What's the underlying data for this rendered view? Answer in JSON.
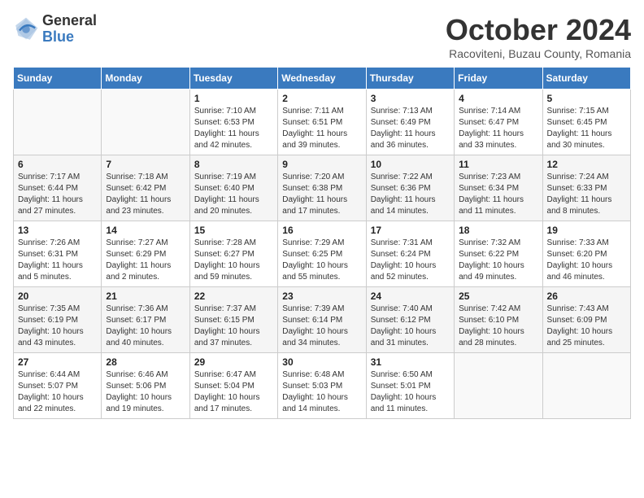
{
  "header": {
    "logo_general": "General",
    "logo_blue": "Blue",
    "month_title": "October 2024",
    "location": "Racoviteni, Buzau County, Romania"
  },
  "days_of_week": [
    "Sunday",
    "Monday",
    "Tuesday",
    "Wednesday",
    "Thursday",
    "Friday",
    "Saturday"
  ],
  "weeks": [
    [
      {
        "day": "",
        "sunrise": "",
        "sunset": "",
        "daylight": ""
      },
      {
        "day": "",
        "sunrise": "",
        "sunset": "",
        "daylight": ""
      },
      {
        "day": "1",
        "sunrise": "Sunrise: 7:10 AM",
        "sunset": "Sunset: 6:53 PM",
        "daylight": "Daylight: 11 hours and 42 minutes."
      },
      {
        "day": "2",
        "sunrise": "Sunrise: 7:11 AM",
        "sunset": "Sunset: 6:51 PM",
        "daylight": "Daylight: 11 hours and 39 minutes."
      },
      {
        "day": "3",
        "sunrise": "Sunrise: 7:13 AM",
        "sunset": "Sunset: 6:49 PM",
        "daylight": "Daylight: 11 hours and 36 minutes."
      },
      {
        "day": "4",
        "sunrise": "Sunrise: 7:14 AM",
        "sunset": "Sunset: 6:47 PM",
        "daylight": "Daylight: 11 hours and 33 minutes."
      },
      {
        "day": "5",
        "sunrise": "Sunrise: 7:15 AM",
        "sunset": "Sunset: 6:45 PM",
        "daylight": "Daylight: 11 hours and 30 minutes."
      }
    ],
    [
      {
        "day": "6",
        "sunrise": "Sunrise: 7:17 AM",
        "sunset": "Sunset: 6:44 PM",
        "daylight": "Daylight: 11 hours and 27 minutes."
      },
      {
        "day": "7",
        "sunrise": "Sunrise: 7:18 AM",
        "sunset": "Sunset: 6:42 PM",
        "daylight": "Daylight: 11 hours and 23 minutes."
      },
      {
        "day": "8",
        "sunrise": "Sunrise: 7:19 AM",
        "sunset": "Sunset: 6:40 PM",
        "daylight": "Daylight: 11 hours and 20 minutes."
      },
      {
        "day": "9",
        "sunrise": "Sunrise: 7:20 AM",
        "sunset": "Sunset: 6:38 PM",
        "daylight": "Daylight: 11 hours and 17 minutes."
      },
      {
        "day": "10",
        "sunrise": "Sunrise: 7:22 AM",
        "sunset": "Sunset: 6:36 PM",
        "daylight": "Daylight: 11 hours and 14 minutes."
      },
      {
        "day": "11",
        "sunrise": "Sunrise: 7:23 AM",
        "sunset": "Sunset: 6:34 PM",
        "daylight": "Daylight: 11 hours and 11 minutes."
      },
      {
        "day": "12",
        "sunrise": "Sunrise: 7:24 AM",
        "sunset": "Sunset: 6:33 PM",
        "daylight": "Daylight: 11 hours and 8 minutes."
      }
    ],
    [
      {
        "day": "13",
        "sunrise": "Sunrise: 7:26 AM",
        "sunset": "Sunset: 6:31 PM",
        "daylight": "Daylight: 11 hours and 5 minutes."
      },
      {
        "day": "14",
        "sunrise": "Sunrise: 7:27 AM",
        "sunset": "Sunset: 6:29 PM",
        "daylight": "Daylight: 11 hours and 2 minutes."
      },
      {
        "day": "15",
        "sunrise": "Sunrise: 7:28 AM",
        "sunset": "Sunset: 6:27 PM",
        "daylight": "Daylight: 10 hours and 59 minutes."
      },
      {
        "day": "16",
        "sunrise": "Sunrise: 7:29 AM",
        "sunset": "Sunset: 6:25 PM",
        "daylight": "Daylight: 10 hours and 55 minutes."
      },
      {
        "day": "17",
        "sunrise": "Sunrise: 7:31 AM",
        "sunset": "Sunset: 6:24 PM",
        "daylight": "Daylight: 10 hours and 52 minutes."
      },
      {
        "day": "18",
        "sunrise": "Sunrise: 7:32 AM",
        "sunset": "Sunset: 6:22 PM",
        "daylight": "Daylight: 10 hours and 49 minutes."
      },
      {
        "day": "19",
        "sunrise": "Sunrise: 7:33 AM",
        "sunset": "Sunset: 6:20 PM",
        "daylight": "Daylight: 10 hours and 46 minutes."
      }
    ],
    [
      {
        "day": "20",
        "sunrise": "Sunrise: 7:35 AM",
        "sunset": "Sunset: 6:19 PM",
        "daylight": "Daylight: 10 hours and 43 minutes."
      },
      {
        "day": "21",
        "sunrise": "Sunrise: 7:36 AM",
        "sunset": "Sunset: 6:17 PM",
        "daylight": "Daylight: 10 hours and 40 minutes."
      },
      {
        "day": "22",
        "sunrise": "Sunrise: 7:37 AM",
        "sunset": "Sunset: 6:15 PM",
        "daylight": "Daylight: 10 hours and 37 minutes."
      },
      {
        "day": "23",
        "sunrise": "Sunrise: 7:39 AM",
        "sunset": "Sunset: 6:14 PM",
        "daylight": "Daylight: 10 hours and 34 minutes."
      },
      {
        "day": "24",
        "sunrise": "Sunrise: 7:40 AM",
        "sunset": "Sunset: 6:12 PM",
        "daylight": "Daylight: 10 hours and 31 minutes."
      },
      {
        "day": "25",
        "sunrise": "Sunrise: 7:42 AM",
        "sunset": "Sunset: 6:10 PM",
        "daylight": "Daylight: 10 hours and 28 minutes."
      },
      {
        "day": "26",
        "sunrise": "Sunrise: 7:43 AM",
        "sunset": "Sunset: 6:09 PM",
        "daylight": "Daylight: 10 hours and 25 minutes."
      }
    ],
    [
      {
        "day": "27",
        "sunrise": "Sunrise: 6:44 AM",
        "sunset": "Sunset: 5:07 PM",
        "daylight": "Daylight: 10 hours and 22 minutes."
      },
      {
        "day": "28",
        "sunrise": "Sunrise: 6:46 AM",
        "sunset": "Sunset: 5:06 PM",
        "daylight": "Daylight: 10 hours and 19 minutes."
      },
      {
        "day": "29",
        "sunrise": "Sunrise: 6:47 AM",
        "sunset": "Sunset: 5:04 PM",
        "daylight": "Daylight: 10 hours and 17 minutes."
      },
      {
        "day": "30",
        "sunrise": "Sunrise: 6:48 AM",
        "sunset": "Sunset: 5:03 PM",
        "daylight": "Daylight: 10 hours and 14 minutes."
      },
      {
        "day": "31",
        "sunrise": "Sunrise: 6:50 AM",
        "sunset": "Sunset: 5:01 PM",
        "daylight": "Daylight: 10 hours and 11 minutes."
      },
      {
        "day": "",
        "sunrise": "",
        "sunset": "",
        "daylight": ""
      },
      {
        "day": "",
        "sunrise": "",
        "sunset": "",
        "daylight": ""
      }
    ]
  ]
}
